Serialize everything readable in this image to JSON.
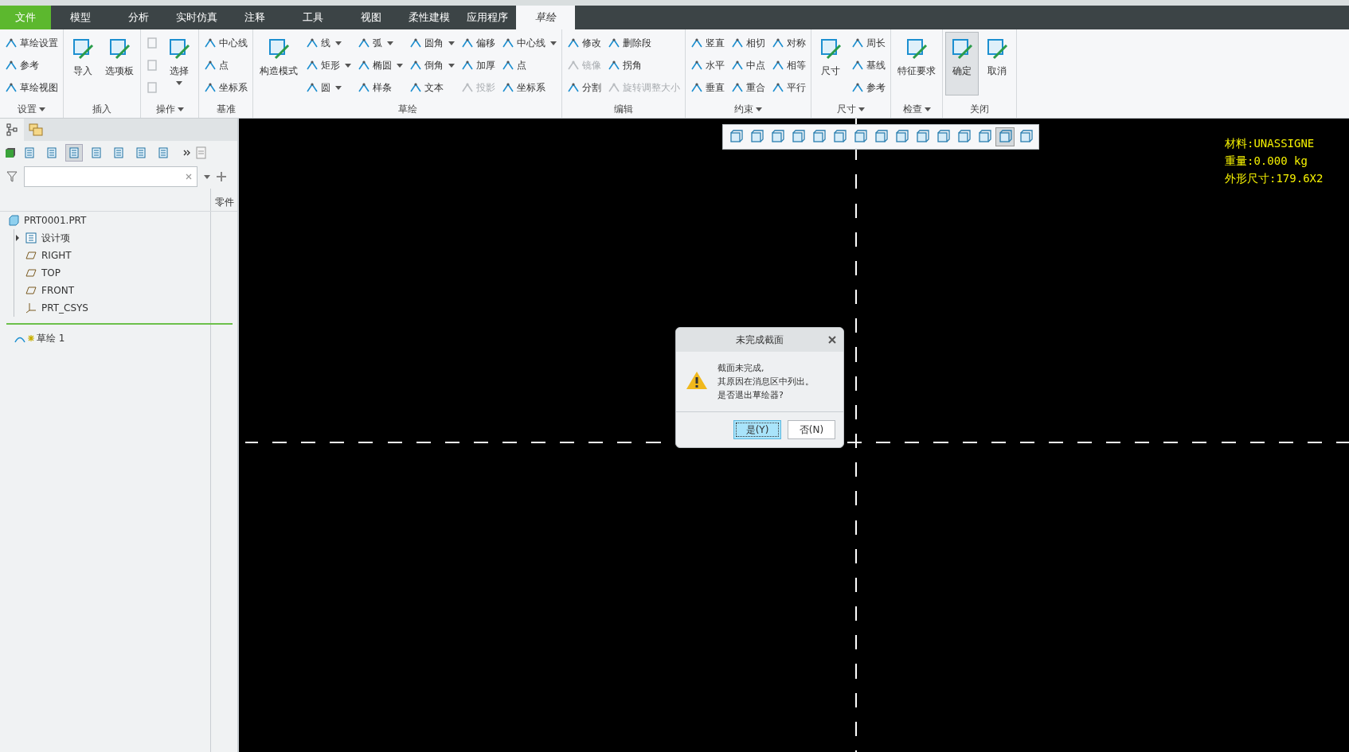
{
  "tabs": [
    {
      "label": "文件",
      "kind": "file",
      "selected": false
    },
    {
      "label": "模型",
      "kind": "tab",
      "selected": false
    },
    {
      "label": "分析",
      "kind": "tab",
      "selected": false
    },
    {
      "label": "实时仿真",
      "kind": "tab",
      "selected": false
    },
    {
      "label": "注释",
      "kind": "tab",
      "selected": false
    },
    {
      "label": "工具",
      "kind": "tab",
      "selected": false
    },
    {
      "label": "视图",
      "kind": "tab",
      "selected": false
    },
    {
      "label": "柔性建模",
      "kind": "tab",
      "selected": false
    },
    {
      "label": "应用程序",
      "kind": "tab",
      "selected": false
    },
    {
      "label": "草绘",
      "kind": "tab",
      "selected": true
    }
  ],
  "ribbon": [
    {
      "label": "设置",
      "menu": true,
      "columns": [
        {
          "kind": "stack",
          "items": [
            {
              "label": "草绘设置",
              "disabled": false,
              "dropdown": false
            },
            {
              "label": "参考",
              "disabled": false,
              "dropdown": false
            },
            {
              "label": "草绘视图",
              "disabled": false,
              "dropdown": false
            }
          ]
        }
      ]
    },
    {
      "label": "插入",
      "menu": false,
      "columns": [
        {
          "kind": "large",
          "items": [
            {
              "label": "导入",
              "disabled": false,
              "dropdown": false,
              "selected": false
            }
          ]
        },
        {
          "kind": "large",
          "items": [
            {
              "label": "选项板",
              "disabled": false,
              "dropdown": false,
              "selected": false
            }
          ]
        }
      ]
    },
    {
      "label": "操作",
      "menu": true,
      "columns": [
        {
          "kind": "icons",
          "items": [
            {
              "disabled": true
            },
            {
              "disabled": true
            },
            {
              "disabled": true
            }
          ]
        },
        {
          "kind": "large",
          "items": [
            {
              "label": "选择",
              "disabled": false,
              "dropdown": true,
              "selected": false
            }
          ]
        }
      ]
    },
    {
      "label": "基准",
      "menu": false,
      "columns": [
        {
          "kind": "stack",
          "items": [
            {
              "label": "中心线",
              "disabled": false,
              "dropdown": false
            },
            {
              "label": "点",
              "disabled": false,
              "dropdown": false
            },
            {
              "label": "坐标系",
              "disabled": false,
              "dropdown": false
            }
          ]
        }
      ]
    },
    {
      "label": "草绘",
      "menu": false,
      "columns": [
        {
          "kind": "large",
          "items": [
            {
              "label": "构造模式",
              "disabled": false,
              "dropdown": false,
              "selected": false
            }
          ]
        },
        {
          "kind": "stack",
          "items": [
            {
              "label": "线",
              "disabled": false,
              "dropdown": true
            },
            {
              "label": "矩形",
              "disabled": false,
              "dropdown": true
            },
            {
              "label": "圆",
              "disabled": false,
              "dropdown": true
            }
          ]
        },
        {
          "kind": "stack",
          "items": [
            {
              "label": "弧",
              "disabled": false,
              "dropdown": true
            },
            {
              "label": "椭圆",
              "disabled": false,
              "dropdown": true
            },
            {
              "label": "样条",
              "disabled": false,
              "dropdown": false
            }
          ]
        },
        {
          "kind": "stack",
          "items": [
            {
              "label": "圆角",
              "disabled": false,
              "dropdown": true
            },
            {
              "label": "倒角",
              "disabled": false,
              "dropdown": true
            },
            {
              "label": "文本",
              "disabled": false,
              "dropdown": false
            }
          ]
        },
        {
          "kind": "stack",
          "items": [
            {
              "label": "偏移",
              "disabled": false,
              "dropdown": false
            },
            {
              "label": "加厚",
              "disabled": false,
              "dropdown": false
            },
            {
              "label": "投影",
              "disabled": true,
              "dropdown": false
            }
          ]
        },
        {
          "kind": "stack",
          "items": [
            {
              "label": "中心线",
              "disabled": false,
              "dropdown": true
            },
            {
              "label": "点",
              "disabled": false,
              "dropdown": false
            },
            {
              "label": "坐标系",
              "disabled": false,
              "dropdown": false
            }
          ]
        }
      ]
    },
    {
      "label": "编辑",
      "menu": false,
      "columns": [
        {
          "kind": "stack",
          "items": [
            {
              "label": "修改",
              "disabled": false,
              "dropdown": false
            },
            {
              "label": "镜像",
              "disabled": true,
              "dropdown": false
            },
            {
              "label": "分割",
              "disabled": false,
              "dropdown": false
            }
          ]
        },
        {
          "kind": "stack",
          "items": [
            {
              "label": "删除段",
              "disabled": false,
              "dropdown": false
            },
            {
              "label": "拐角",
              "disabled": false,
              "dropdown": false
            },
            {
              "label": "旋转调整大小",
              "disabled": true,
              "dropdown": false
            }
          ]
        }
      ]
    },
    {
      "label": "约束",
      "menu": true,
      "columns": [
        {
          "kind": "stack",
          "items": [
            {
              "label": "竖直",
              "disabled": false,
              "dropdown": false
            },
            {
              "label": "水平",
              "disabled": false,
              "dropdown": false
            },
            {
              "label": "垂直",
              "disabled": false,
              "dropdown": false
            }
          ]
        },
        {
          "kind": "stack",
          "items": [
            {
              "label": "相切",
              "disabled": false,
              "dropdown": false
            },
            {
              "label": "中点",
              "disabled": false,
              "dropdown": false
            },
            {
              "label": "重合",
              "disabled": false,
              "dropdown": false
            }
          ]
        },
        {
          "kind": "stack",
          "items": [
            {
              "label": "对称",
              "disabled": false,
              "dropdown": false
            },
            {
              "label": "相等",
              "disabled": false,
              "dropdown": false
            },
            {
              "label": "平行",
              "disabled": false,
              "dropdown": false
            }
          ]
        }
      ]
    },
    {
      "label": "尺寸",
      "menu": true,
      "columns": [
        {
          "kind": "large",
          "items": [
            {
              "label": "尺寸",
              "disabled": false,
              "dropdown": false,
              "selected": false
            }
          ]
        },
        {
          "kind": "stack",
          "items": [
            {
              "label": "周长",
              "disabled": false,
              "dropdown": false
            },
            {
              "label": "基线",
              "disabled": false,
              "dropdown": false
            },
            {
              "label": "参考",
              "disabled": false,
              "dropdown": false
            }
          ]
        }
      ]
    },
    {
      "label": "检查",
      "menu": true,
      "columns": [
        {
          "kind": "large",
          "items": [
            {
              "label": "特征要求",
              "disabled": false,
              "dropdown": false,
              "selected": false
            }
          ]
        }
      ]
    },
    {
      "label": "关闭",
      "menu": false,
      "columns": [
        {
          "kind": "large",
          "items": [
            {
              "label": "确定",
              "disabled": false,
              "dropdown": false,
              "selected": true
            }
          ]
        },
        {
          "kind": "large",
          "items": [
            {
              "label": "取消",
              "disabled": false,
              "dropdown": false,
              "selected": false
            }
          ]
        }
      ]
    }
  ],
  "sidebar": {
    "panel_tabs": [
      {
        "selected": true
      },
      {
        "selected": false
      }
    ],
    "column_header": "零件",
    "tree": [
      {
        "label": "PRT0001.PRT",
        "kind": "part",
        "children": [
          {
            "label": "设计项",
            "kind": "folder",
            "expanded": false
          },
          {
            "label": "RIGHT",
            "kind": "plane"
          },
          {
            "label": "TOP",
            "kind": "plane"
          },
          {
            "label": "FRONT",
            "kind": "plane"
          },
          {
            "label": "PRT_CSYS",
            "kind": "csys"
          }
        ]
      }
    ],
    "after_insert": [
      {
        "label": "草绘 1",
        "kind": "sketch",
        "new": true
      }
    ]
  },
  "view_toolbar": {
    "buttons": [
      {
        "selected": false
      },
      {
        "selected": false
      },
      {
        "selected": false
      },
      {
        "selected": false
      },
      {
        "selected": false
      },
      {
        "selected": false
      },
      {
        "selected": false
      },
      {
        "selected": false
      },
      {
        "selected": false
      },
      {
        "selected": false
      },
      {
        "selected": false
      },
      {
        "selected": false
      },
      {
        "selected": false
      },
      {
        "selected": true
      },
      {
        "selected": false
      }
    ]
  },
  "model_info": [
    "材料:UNASSIGNE",
    "重量:0.000 kg",
    "外形尺寸:179.6X2"
  ],
  "dialog": {
    "title": "未完成截面",
    "message": [
      "截面未完成,",
      "其原因在消息区中列出。",
      "是否退出草绘器?"
    ],
    "buttons": [
      {
        "label": "是(Y)",
        "default": true
      },
      {
        "label": "否(N)",
        "default": false
      }
    ]
  }
}
